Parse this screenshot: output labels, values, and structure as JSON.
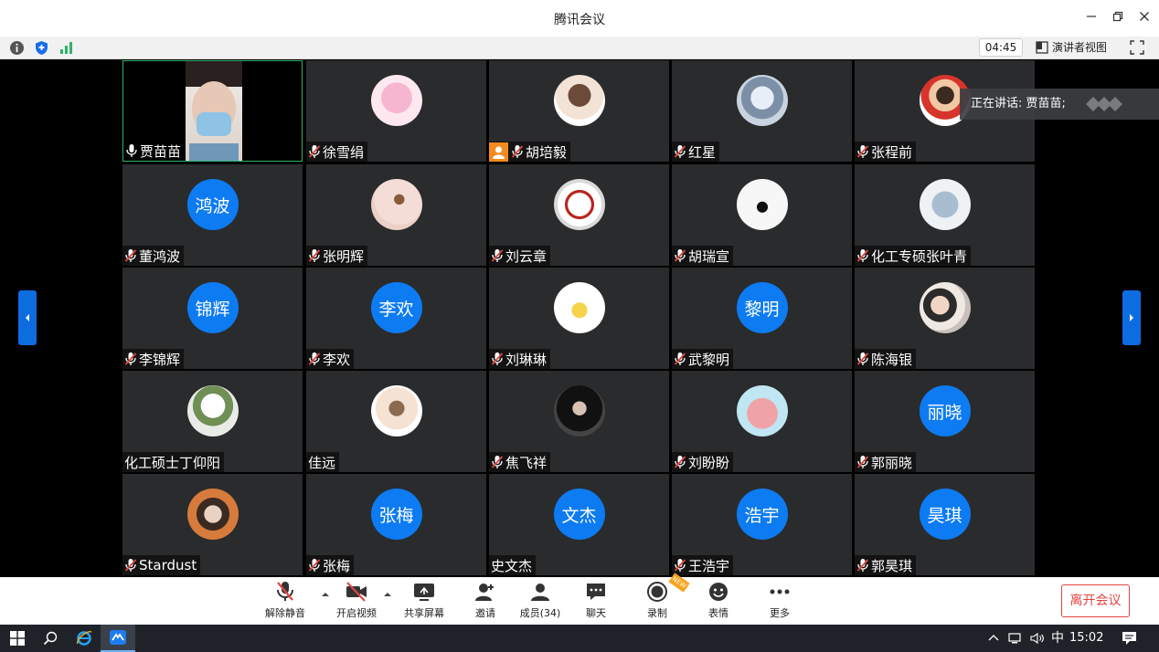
{
  "window": {
    "title": "腾讯会议"
  },
  "infobar": {
    "timer": "04:45",
    "speaker_view_label": "演讲者视图"
  },
  "speaking": {
    "text": "正在讲话: 贾苗苗;"
  },
  "participants": [
    {
      "name": "贾苗苗",
      "mic": "on",
      "mode": "video"
    },
    {
      "name": "徐雪绢",
      "mic": "muted",
      "mode": "image",
      "avatar": "pink-cartoon-avatar"
    },
    {
      "name": "胡培毅",
      "mic": "muted",
      "mode": "image",
      "avatar": "anime-boy-avatar",
      "host": true
    },
    {
      "name": "红星",
      "mic": "muted",
      "mode": "image",
      "avatar": "ghost-avatar"
    },
    {
      "name": "张程前",
      "mic": "muted",
      "mode": "image",
      "avatar": "cartoon-kid-avatar"
    },
    {
      "name": "董鸿波",
      "mic": "muted",
      "mode": "text",
      "avatar_text": "鸿波"
    },
    {
      "name": "张明辉",
      "mic": "muted",
      "mode": "image",
      "avatar": "butterfly-avatar"
    },
    {
      "name": "刘云章",
      "mic": "muted",
      "mode": "image",
      "avatar": "calligraphy-avatar"
    },
    {
      "name": "胡瑞宣",
      "mic": "muted",
      "mode": "image",
      "avatar": "sketch-avatar"
    },
    {
      "name": "化工专硕张叶青",
      "mic": "muted",
      "mode": "image",
      "avatar": "cat-avatar"
    },
    {
      "name": "李锦辉",
      "mic": "muted",
      "mode": "text",
      "avatar_text": "锦辉"
    },
    {
      "name": "李欢",
      "mic": "muted",
      "mode": "text",
      "avatar_text": "李欢"
    },
    {
      "name": "刘琳琳",
      "mic": "muted",
      "mode": "image",
      "avatar": "drawing-girl-avatar"
    },
    {
      "name": "武黎明",
      "mic": "muted",
      "mode": "text",
      "avatar_text": "黎明"
    },
    {
      "name": "陈海银",
      "mic": "muted",
      "mode": "image",
      "avatar": "couple-photo-avatar"
    },
    {
      "name": "化工硕士丁仰阳",
      "mic": "none",
      "mode": "image",
      "avatar": "flower-avatar"
    },
    {
      "name": "佳远",
      "mic": "none",
      "mode": "image",
      "avatar": "anime-child-avatar"
    },
    {
      "name": "焦飞祥",
      "mic": "muted",
      "mode": "image",
      "avatar": "dark-portrait-avatar"
    },
    {
      "name": "刘盼盼",
      "mic": "muted",
      "mode": "image",
      "avatar": "pig-avatar"
    },
    {
      "name": "郭丽晓",
      "mic": "muted",
      "mode": "text",
      "avatar_text": "丽晓"
    },
    {
      "name": "Stardust",
      "mic": "muted",
      "mode": "image",
      "avatar": "selfie-avatar"
    },
    {
      "name": "张梅",
      "mic": "muted",
      "mode": "text",
      "avatar_text": "张梅"
    },
    {
      "name": "史文杰",
      "mic": "none",
      "mode": "text",
      "avatar_text": "文杰"
    },
    {
      "name": "王浩宇",
      "mic": "muted",
      "mode": "text",
      "avatar_text": "浩宇"
    },
    {
      "name": "郭昊琪",
      "mic": "muted",
      "mode": "text",
      "avatar_text": "昊琪"
    }
  ],
  "toolbar": {
    "unmute": "解除静音",
    "start_video": "开启视频",
    "share_screen": "共享屏幕",
    "invite": "邀请",
    "members": "成员(34)",
    "chat": "聊天",
    "record": "录制",
    "emoji": "表情",
    "more": "更多",
    "leave": "离开会议",
    "new_badge": "NEW"
  },
  "taskbar": {
    "ime": "中",
    "clock": "15:02"
  },
  "colors": {
    "accent": "#0d7bf2",
    "leave": "#e0463f",
    "active_border": "#2fb36b",
    "tile_bg": "#2a2b2d"
  }
}
